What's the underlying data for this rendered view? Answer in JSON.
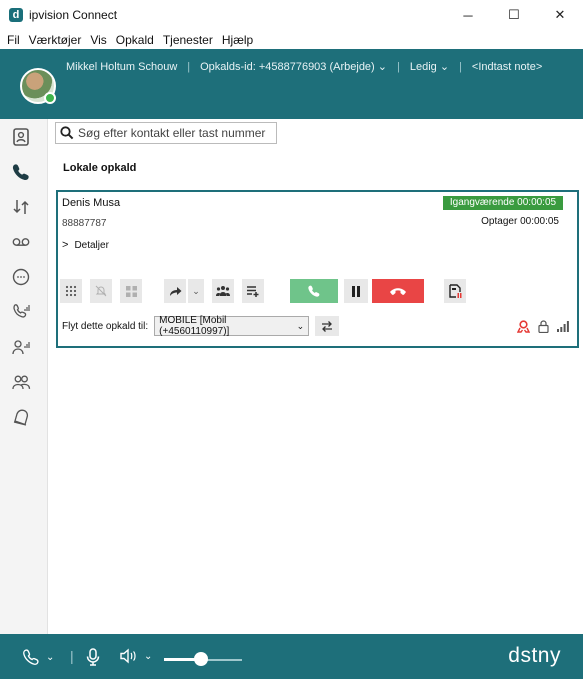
{
  "window": {
    "title": "ipvision Connect",
    "logo_letter": "d",
    "controls": {
      "minimize": "─",
      "maximize": "☐",
      "close": "✕"
    }
  },
  "menu": {
    "items": [
      "Fil",
      "Værktøjer",
      "Vis",
      "Opkald",
      "Tjenester",
      "Hjælp"
    ]
  },
  "header": {
    "user_name": "Mikkel Holtum Schouw",
    "caller_id": "Opkalds-id: +4588776903 (Arbejde) ⌄",
    "status": "Ledig ⌄",
    "note_placeholder": "<Indtast note>",
    "presence_color": "#3fb44b"
  },
  "search": {
    "placeholder": "Søg efter kontakt eller tast nummer"
  },
  "section": {
    "title": "Lokale opkald"
  },
  "call": {
    "caller_name": "Denis Musa",
    "caller_number": "88887787",
    "details_label": "Detaljer",
    "status_badge": "Igangværende 00:00:05",
    "recording": "Optager 00:00:05",
    "transfer_label": "Flyt dette opkald til:",
    "transfer_value": "MOBILE [Mobil (+4560110997)]",
    "status_color": "#3a9b3f"
  },
  "footer": {
    "brand": "dstny",
    "volume_level_percent": 48
  },
  "colors": {
    "teal": "#1e6f7a",
    "hangup": "#e94545",
    "answer": "#6fc48a"
  }
}
